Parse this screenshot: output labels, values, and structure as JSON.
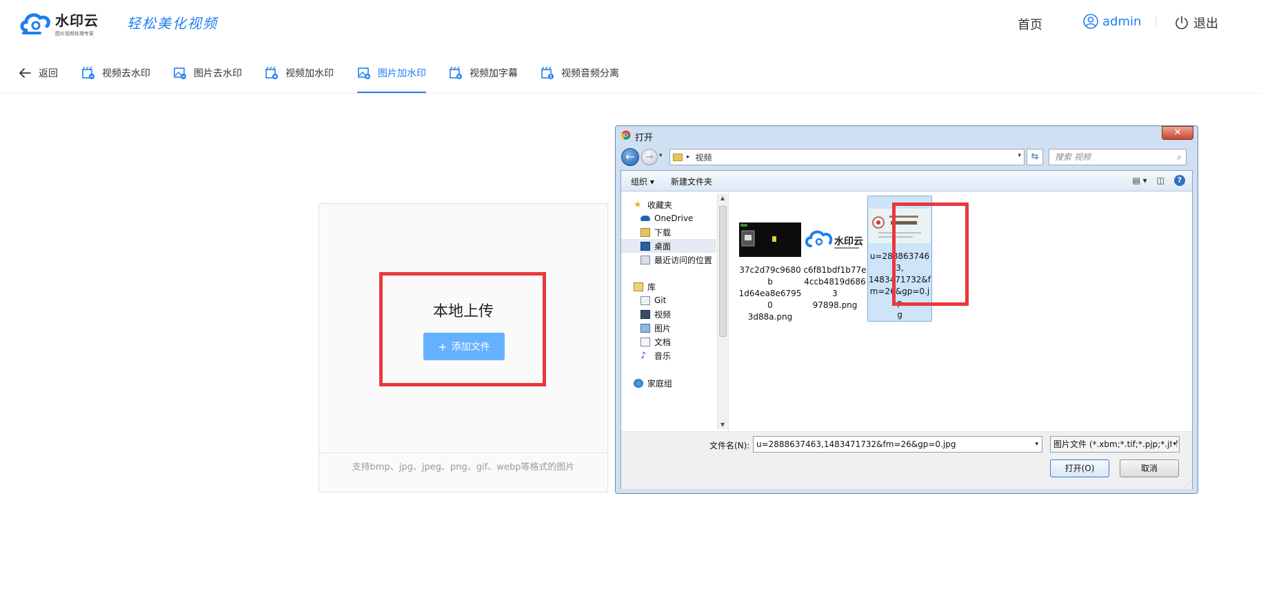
{
  "header": {
    "logo_name": "水印云",
    "logo_sub": "图片视频处理专家",
    "slogan": "轻松美化视频",
    "home_label": "首页",
    "user_label": "admin",
    "logout_label": "退出",
    "accent_color": "#1e7ff0"
  },
  "tabs": {
    "back_label": "返回",
    "items": [
      {
        "label": "视频去水印",
        "icon": "video-icon"
      },
      {
        "label": "图片去水印",
        "icon": "image-icon"
      },
      {
        "label": "视频加水印",
        "icon": "video-icon"
      },
      {
        "label": "图片加水印",
        "icon": "image-icon",
        "active": true
      },
      {
        "label": "视频加字幕",
        "icon": "video-icon"
      },
      {
        "label": "视频音频分离",
        "icon": "video-icon"
      }
    ]
  },
  "upload": {
    "title": "本地上传",
    "add_button": "添加文件",
    "hint": "支持bmp、jpg、jpeg、png、gif、webp等格式的图片"
  },
  "dialog": {
    "title": "打开",
    "close_glyph": "✕",
    "address_path": "视频",
    "search_placeholder": "搜索 视频",
    "toolbar": {
      "organize": "组织 ▾",
      "new_folder": "新建文件夹"
    },
    "tree": [
      {
        "label": "收藏夹",
        "icon": "star-icon"
      },
      {
        "label": "OneDrive",
        "icon": "cloud-icon"
      },
      {
        "label": "下载",
        "icon": "download-folder-icon"
      },
      {
        "label": "桌面",
        "icon": "desktop-icon",
        "selected": true
      },
      {
        "label": "最近访问的位置",
        "icon": "recent-places-icon"
      },
      {
        "label": "库",
        "icon": "library-icon"
      },
      {
        "label": "Git",
        "icon": "git-library-icon"
      },
      {
        "label": "视频",
        "icon": "video-library-icon"
      },
      {
        "label": "图片",
        "icon": "picture-library-icon"
      },
      {
        "label": "文档",
        "icon": "document-library-icon"
      },
      {
        "label": "音乐",
        "icon": "music-library-icon"
      },
      {
        "label": "家庭组",
        "icon": "homegroup-icon"
      }
    ],
    "files": [
      {
        "name": "37c2d79c9680b1d64ea8e679503d88a.png",
        "lines": [
          "37c2d79c9680b",
          "1d64ea8e67950",
          "3d88a.png"
        ]
      },
      {
        "name": "c6f81bdf1b77e4ccb4819d686397898.png",
        "lines": [
          "c6f81bdf1b77e",
          "4ccb4819d6863",
          "97898.png"
        ]
      },
      {
        "name": "u=2888637463,1483471732&fm=26&gp=0.jpg",
        "lines": [
          "u=2888637463,",
          "1483471732&f",
          "m=26&gp=0.jp",
          "g"
        ],
        "selected": true
      }
    ],
    "filename_label": "文件名(N):",
    "filename_value": "u=2888637463,1483471732&fm=26&gp=0.jpg",
    "filetype_value": "图片文件 (*.xbm;*.tif;*.pjp;*.jfif",
    "open_button": "打开(O)",
    "cancel_button": "取消"
  }
}
